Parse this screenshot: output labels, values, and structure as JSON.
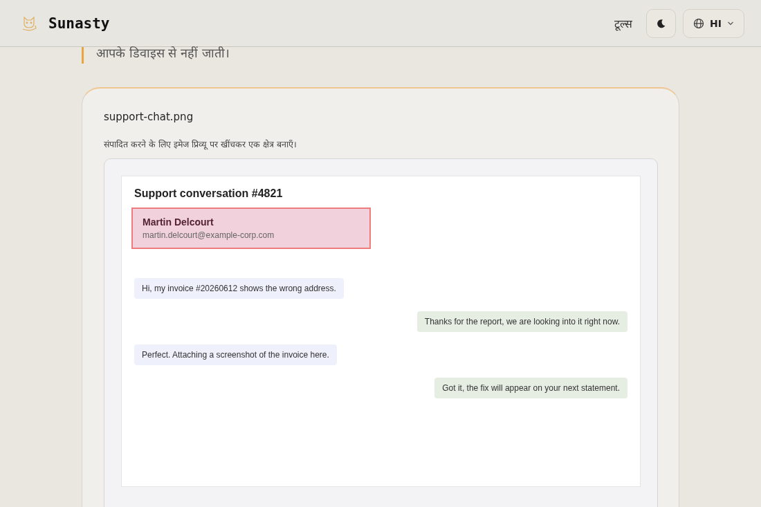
{
  "header": {
    "brand": "Sunasty",
    "nav_link": "टूल्स",
    "language": "HI"
  },
  "quote": "आपके डिवाइस से नहीं जाती।",
  "card": {
    "filename": "support-chat.png",
    "hint": "संपादित करने के लिए इमेज प्रिव्यू पर खींचकर एक क्षेत्र बनाएँ।",
    "preview": {
      "title": "Support conversation #4821",
      "contact": {
        "name": "Martin Delcourt",
        "email": "martin.delcourt@example-corp.com",
        "selected": true
      },
      "messages": [
        {
          "kind": "incoming",
          "text": "Hi, my invoice #20260612 shows the wrong address."
        },
        {
          "kind": "outgoing",
          "text": "Thanks for the report, we are looking into it right now."
        },
        {
          "kind": "incoming",
          "text": "Perfect. Attaching a screenshot of the invoice here."
        },
        {
          "kind": "outgoing",
          "text": "Got it, the fix will appear on your next statement."
        }
      ]
    }
  }
}
